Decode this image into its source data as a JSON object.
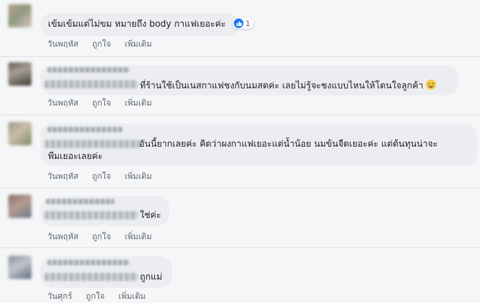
{
  "comments": [
    {
      "text": "เข้มเข้มแต่ไม่ขม หมายถึง body กาแฟเยอะค่ะ",
      "reaction_count": "1",
      "reaction_icon": "like-icon",
      "day": "วันพฤหัส",
      "like": "ถูกใจ",
      "more": "เพิ่มเติม"
    },
    {
      "text": "ที่ร้านใช้เป็นเนสกาแฟชงกับนมสดค่ะ เลยไม่รู้จะชงแบบไหนให้โดนใจลูกค้า",
      "trailing_icon": "grinning-face-emoji",
      "day": "วันพฤหัส",
      "like": "ถูกใจ",
      "more": "เพิ่มเติม"
    },
    {
      "text_line1": "อันนี้ยากเลยค่ะ คิดว่าผงกาแฟเยอะแต่น้ำน้อย นมข้นจืดเยอะค่ะ แต่ต้นทุนน่าจะ",
      "text_line2": "พีมเยอะเลยค่ะ",
      "day": "วันพฤหัส",
      "like": "ถูกใจ",
      "more": "เพิ่มเติม"
    },
    {
      "text": "ใช่ค่ะ",
      "day": "วันพฤหัส",
      "like": "ถูกใจ",
      "more": "เพิ่มเติม"
    },
    {
      "text": "ถูกแม่",
      "day": "วันศุกร์",
      "like": "ถูกใจ",
      "more": "เพิ่มเติม"
    }
  ],
  "colors": {
    "background": "#f5f6f7",
    "bubble": "#ebedf0",
    "action_text": "#606770",
    "like_blue": "#1877f2"
  }
}
